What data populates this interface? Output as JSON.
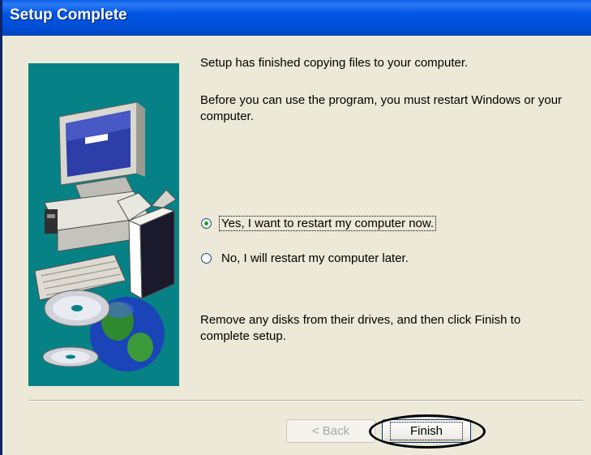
{
  "window": {
    "title": "Setup Complete"
  },
  "messages": {
    "copied": "Setup has finished copying files to your computer.",
    "restart_required": "Before you can use the program, you must restart Windows or your computer.",
    "remove_disks": "Remove any disks from their drives, and then click Finish to complete setup."
  },
  "options": [
    {
      "label": "Yes, I want to restart my computer now.",
      "selected": true
    },
    {
      "label": "No, I will restart my computer later.",
      "selected": false
    }
  ],
  "buttons": {
    "back_label": "< Back",
    "back_enabled": false,
    "finish_label": "Finish"
  },
  "colors": {
    "titlebar": "#0054e3",
    "window_bg": "#ece9d8",
    "image_panel_bg": "#068286",
    "highlight_annotation": "#000000"
  },
  "icons": {
    "panel_image": "computer-cd-globe-illustration"
  }
}
